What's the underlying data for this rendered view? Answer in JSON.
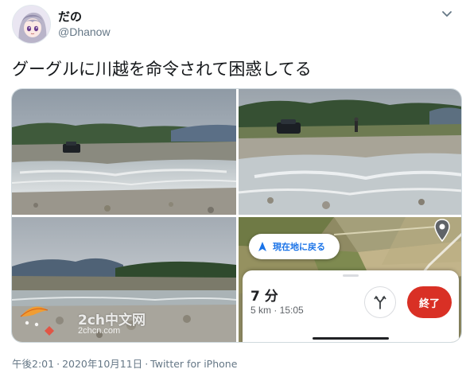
{
  "tweet": {
    "display_name": "だの",
    "handle": "@Dhanow",
    "text": "グーグルに川越を命令されて困惑してる",
    "time": "午後2:01",
    "separator": "·",
    "date": "2020年10月11日",
    "source": "Twitter for iPhone"
  },
  "media": {
    "photos": [
      {
        "subject": "river-crossing-wide"
      },
      {
        "subject": "car-in-riverbed"
      },
      {
        "subject": "river-and-mountains"
      },
      {
        "subject": "google-maps-navigation"
      }
    ]
  },
  "map_ui": {
    "recenter_label": "現在地に戻る",
    "eta": "7 分",
    "distance_time": "5 km · 15:05",
    "end_label": "終了",
    "accent": "#1a73e8",
    "end_color": "#d93025"
  },
  "watermark": {
    "site_name": "2ch中文网",
    "site_url": "2chcn.com"
  },
  "icons": {
    "more": "chevron-down-icon",
    "recenter": "navigation-arrow-icon",
    "alternate_route": "route-fork-icon",
    "destination": "location-pin-icon"
  }
}
